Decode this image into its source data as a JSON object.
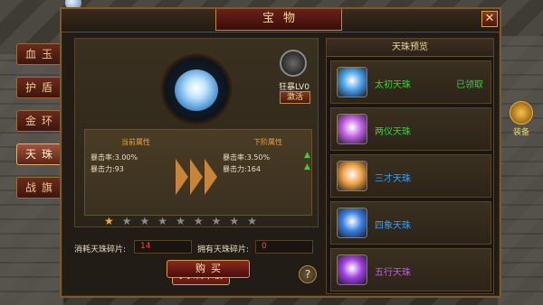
{
  "window": {
    "title": "宝物"
  },
  "side_tabs": [
    {
      "label": "血玉",
      "active": false
    },
    {
      "label": "护盾",
      "active": false
    },
    {
      "label": "金环",
      "active": false
    },
    {
      "label": "天珠",
      "active": true
    },
    {
      "label": "战旗",
      "active": false
    }
  ],
  "right_badge": {
    "label": "装备"
  },
  "display": {
    "orb_button": "禁出",
    "rage_level": "狂暴LV0",
    "activate_button": "激活"
  },
  "attributes": {
    "current_title": "当前属性",
    "next_title": "下阶属性",
    "current": [
      "暴击率:3.00%",
      "暴击力:93"
    ],
    "next": [
      "暴击率:3.50%",
      "暴击力:164"
    ]
  },
  "stars": {
    "filled": 1,
    "total": 9
  },
  "cost": {
    "consume_label": "消耗天珠碎片:",
    "consume_value": "14",
    "own_label": "拥有天珠碎片:",
    "own_value": "0"
  },
  "buttons": {
    "upgrade": "天珠升级",
    "help": "?",
    "buy": "购买",
    "close": "✕"
  },
  "preview": {
    "title": "天珠预览",
    "items": [
      {
        "name": "太初天珠",
        "status": "已领取",
        "name_color": "#3ad03a",
        "icon_color": "#4aa0e8"
      },
      {
        "name": "两仪天珠",
        "status": "",
        "name_color": "#3ad03a",
        "icon_color": "#c060e0"
      },
      {
        "name": "三才天珠",
        "status": "",
        "name_color": "#3aa0f0",
        "icon_color": "#f0a040"
      },
      {
        "name": "四象天珠",
        "status": "",
        "name_color": "#3aa0f0",
        "icon_color": "#3a80e0"
      },
      {
        "name": "五行天珠",
        "status": "",
        "name_color": "#c060e0",
        "icon_color": "#a040e0"
      }
    ]
  }
}
